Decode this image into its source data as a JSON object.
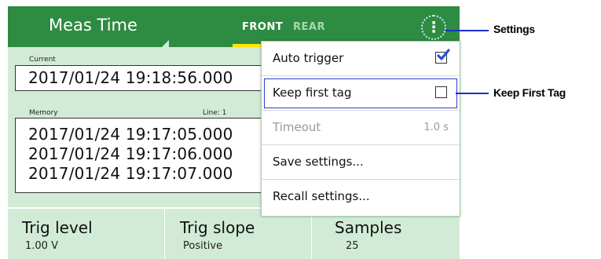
{
  "header": {
    "title": "Meas Time",
    "tabs": [
      {
        "label": "FRONT",
        "active": true
      },
      {
        "label": "REAR",
        "active": false
      }
    ],
    "menu_button": "⋮"
  },
  "current": {
    "label": "Current",
    "value": "2017/01/24 19:18:56.000"
  },
  "memory": {
    "label": "Memory",
    "line_label": "Line: 1",
    "values": [
      "2017/01/24 19:17:05.000",
      "2017/01/24 19:17:06.000",
      "2017/01/24 19:17:07.000"
    ]
  },
  "stats": [
    {
      "title": "Trig level",
      "value": "1.00 V"
    },
    {
      "title": "Trig slope",
      "value": "Positive"
    },
    {
      "title": "Samples",
      "value": "25"
    }
  ],
  "menu": {
    "items": [
      {
        "label": "Auto trigger",
        "type": "checkbox",
        "checked": true
      },
      {
        "label": "Keep first tag",
        "type": "checkbox",
        "checked": false
      },
      {
        "label": "Timeout",
        "type": "value",
        "value": "1.0 s",
        "disabled": true
      },
      {
        "label": "Save settings...",
        "type": "action"
      },
      {
        "label": "Recall settings...",
        "type": "action"
      }
    ]
  },
  "annotations": {
    "settings": "Settings",
    "keep_first_tag": "Keep First Tag"
  },
  "colors": {
    "header_green": "#2e8b42",
    "panel_green": "#d2ebd7",
    "tab_underline": "#ffe600",
    "annotation_blue": "#1a2fcc"
  }
}
